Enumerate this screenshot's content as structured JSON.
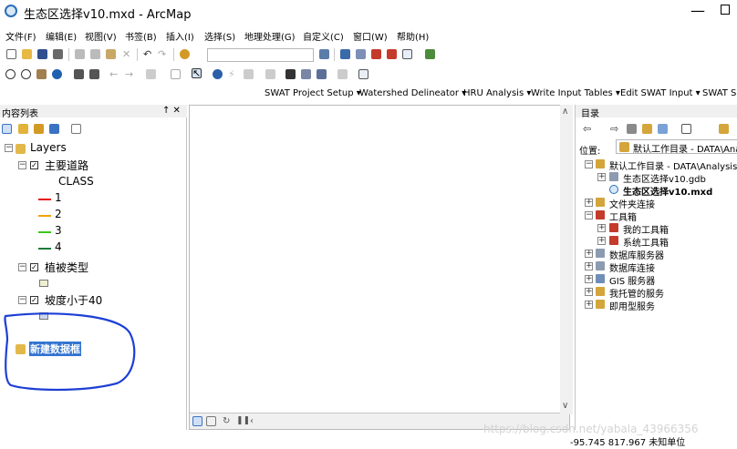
{
  "window": {
    "title": "生态区选择v10.mxd - ArcMap",
    "minimize": "—"
  },
  "menu": [
    {
      "label": "文件(F)"
    },
    {
      "label": "编辑(E)"
    },
    {
      "label": "视图(V)"
    },
    {
      "label": "书签(B)"
    },
    {
      "label": "插入(I)"
    },
    {
      "label": "选择(S)"
    },
    {
      "label": "地理处理(G)"
    },
    {
      "label": "自定义(C)"
    },
    {
      "label": "窗口(W)"
    },
    {
      "label": "帮助(H)"
    }
  ],
  "swat_toolbar": [
    {
      "label": "SWAT Project Setup ▾"
    },
    {
      "label": "Watershed Delineator ▾"
    },
    {
      "label": "HRU Analysis ▾"
    },
    {
      "label": "Write Input Tables ▾"
    },
    {
      "label": "Edit SWAT Input ▾"
    },
    {
      "label": "SWAT Si"
    }
  ],
  "toc": {
    "title": "内容列表",
    "pin": "↑ ✕",
    "root": "Layers",
    "layers": [
      {
        "name": "主要道路",
        "field": "CLASS",
        "classes": [
          {
            "label": "1",
            "color": "#e8101a"
          },
          {
            "label": "2",
            "color": "#f0a400"
          },
          {
            "label": "3",
            "color": "#3fc51a"
          },
          {
            "label": "4",
            "color": "#1f7a3a"
          }
        ]
      },
      {
        "name": "植被类型",
        "swatch": "#eef0d2"
      },
      {
        "name": "坡度小于40",
        "swatch": "#cdd8ef"
      }
    ],
    "new_frame": "新建数据框"
  },
  "catalog": {
    "title": "目录",
    "location_label": "位置:",
    "location_value": "默认工作目录 - DATA\\Analys",
    "tree": [
      {
        "label": "默认工作目录 - DATA\\Analysis",
        "bold": false
      },
      {
        "label": "生态区选择v10.gdb",
        "bold": false
      },
      {
        "label": "生态区选择v10.mxd",
        "bold": true
      },
      {
        "label": "文件夹连接",
        "bold": false
      },
      {
        "label": "工具箱",
        "bold": false
      },
      {
        "label": "我的工具箱",
        "bold": false
      },
      {
        "label": "系统工具箱",
        "bold": false
      },
      {
        "label": "数据库服务器",
        "bold": false
      },
      {
        "label": "数据库连接",
        "bold": false
      },
      {
        "label": "GIS 服务器",
        "bold": false
      },
      {
        "label": "我托管的服务",
        "bold": false
      },
      {
        "label": "即用型服务",
        "bold": false
      }
    ]
  },
  "status": {
    "coords": "-95.745  817.967 未知单位",
    "watermark": "https://blog.csdn.net/yabala_43966356"
  }
}
